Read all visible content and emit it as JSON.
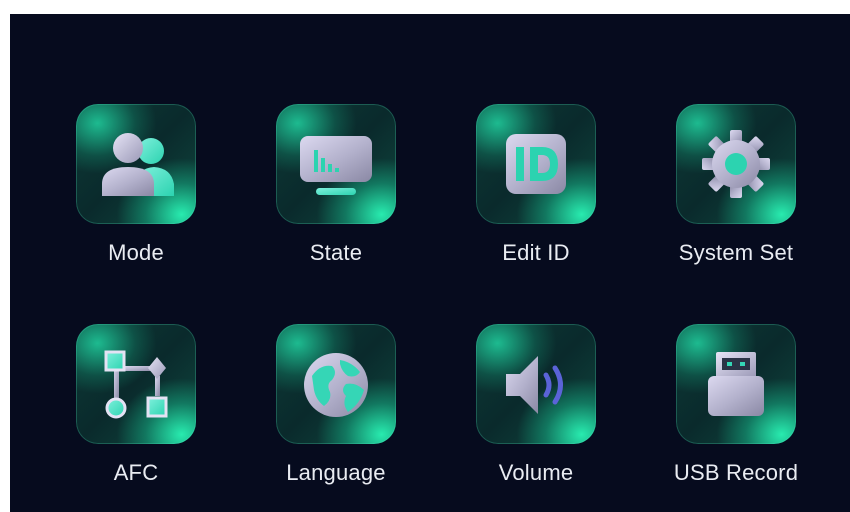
{
  "menu": {
    "items": [
      {
        "label": "Mode",
        "icon": "users-icon"
      },
      {
        "label": "State",
        "icon": "monitor-chart-icon"
      },
      {
        "label": "Edit ID",
        "icon": "id-icon"
      },
      {
        "label": "System Set",
        "icon": "gear-icon"
      },
      {
        "label": "AFC",
        "icon": "flowchart-icon"
      },
      {
        "label": "Language",
        "icon": "globe-icon"
      },
      {
        "label": "Volume",
        "icon": "speaker-icon"
      },
      {
        "label": "USB Record",
        "icon": "usb-drive-icon"
      }
    ]
  },
  "colors": {
    "background": "#060b1e",
    "accent": "#3ee0b8",
    "label": "#e9ecf2",
    "volume_wave": "#5b63d8"
  }
}
